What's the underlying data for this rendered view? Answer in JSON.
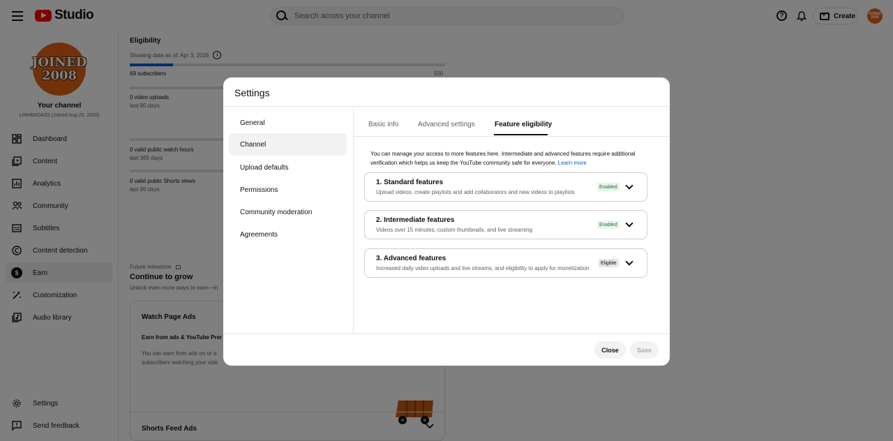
{
  "header": {
    "logo_text": "Studio",
    "search_placeholder": "Search across your channel",
    "create_label": "Create",
    "avatar_text": "JOINED 2008"
  },
  "sidebar": {
    "avatar_line1": "JOINED",
    "avatar_line2": "2008",
    "channel_title": "Your channel",
    "channel_sub": "LINHBADASS (Joined Aug 20, 2008)",
    "items": [
      {
        "label": "Dashboard",
        "icon": "dashboard-icon"
      },
      {
        "label": "Content",
        "icon": "content-icon"
      },
      {
        "label": "Analytics",
        "icon": "analytics-icon"
      },
      {
        "label": "Community",
        "icon": "community-icon"
      },
      {
        "label": "Subtitles",
        "icon": "subtitles-icon"
      },
      {
        "label": "Content detection",
        "icon": "copyright-icon"
      },
      {
        "label": "Earn",
        "icon": "dollar-icon"
      },
      {
        "label": "Customization",
        "icon": "wand-icon"
      },
      {
        "label": "Audio library",
        "icon": "audio-library-icon"
      }
    ],
    "settings_label": "Settings",
    "feedback_label": "Send feedback"
  },
  "main": {
    "eligibility_title": "Eligibility",
    "data_as_of": "Showing data as of: Apr 3, 2026",
    "subscribers": "69 subscribers",
    "subscribers_max": "500",
    "subscribers_progress": 0.138,
    "uploads": "0 video uploads",
    "uploads_period": "last 90 days",
    "watch_hours": "0 valid public watch hours",
    "watch_period": "last 365 days",
    "shorts_views": "0 valid public Shorts views",
    "shorts_period": "last 90 days",
    "milestone_label": "Future milestone",
    "milestone_title": "Continue to grow",
    "milestone_sub": "Unlock even more ways to earn—in",
    "card_title": "Watch Page Ads",
    "card_sub": "Earn from ads & YouTube Prer",
    "card_text": "You can earn from ads on or a subscribers watching your vide",
    "card_foot_title": "Shorts Feed Ads"
  },
  "dialog": {
    "title": "Settings",
    "nav": [
      "General",
      "Channel",
      "Upload defaults",
      "Permissions",
      "Community moderation",
      "Agreements"
    ],
    "active_nav": "Channel",
    "tabs": [
      "Basic info",
      "Advanced settings",
      "Feature eligibility"
    ],
    "active_tab": "Feature eligibility",
    "intro": "You can manage your access to more features here. Intermediate and advanced features require additional verification which helps us keep the YouTube community safe for everyone.",
    "learn_more": "Learn more",
    "features": [
      {
        "title": "1. Standard features",
        "desc": "Upload videos, create playlists and add collaborators and new videos to playlists",
        "status": "Enabled"
      },
      {
        "title": "2. Intermediate features",
        "desc": "Videos over 15 minutes, custom thumbnails, and live streaming",
        "status": "Enabled"
      },
      {
        "title": "3. Advanced features",
        "desc": "Increased daily video uploads and live streams, and eligibility to apply for monetization",
        "status": "Eligible"
      }
    ],
    "close_label": "Close",
    "save_label": "Save"
  },
  "colors": {
    "accent": "#065fd4",
    "brand": "#ff0000",
    "enabled_bg": "#e6f4ea",
    "enabled_text": "#1e6e34",
    "avatar": "#e36414"
  }
}
